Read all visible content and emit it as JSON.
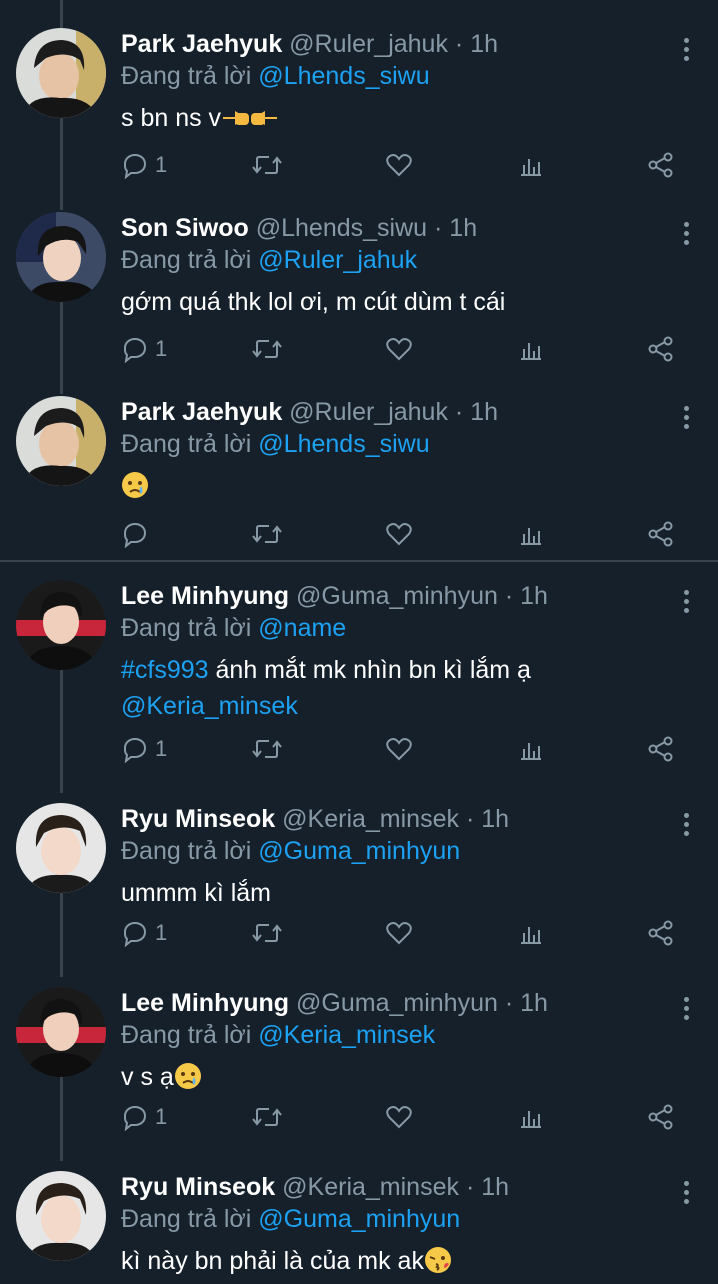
{
  "tweets": [
    {
      "name": "Park Jaehyuk",
      "handle": "@Ruler_jahuk",
      "time": "· 1h",
      "reply_prefix": "Đang trả lời",
      "reply_to": "@Lhends_siwu",
      "text": "s bn ns v",
      "reply_count": "1"
    },
    {
      "name": "Son Siwoo",
      "handle": "@Lhends_siwu",
      "time": "· 1h",
      "reply_prefix": "Đang trả lời",
      "reply_to": "@Ruler_jahuk",
      "text": "gớm quá thk lol ơi, m cút dùm t cái",
      "reply_count": "1"
    },
    {
      "name": "Park Jaehyuk",
      "handle": "@Ruler_jahuk",
      "time": "· 1h",
      "reply_prefix": "Đang trả lời",
      "reply_to": "@Lhends_siwu",
      "text": "",
      "reply_count": ""
    },
    {
      "name": "Lee Minhyung",
      "handle": "@Guma_minhyun",
      "time": "· 1h",
      "reply_prefix": "Đang trả lời",
      "reply_to": "@name",
      "hashtag": "#cfs993",
      "text": "ánh mắt mk nhìn bn kì lắm ạ",
      "mention_line": "@Keria_minsek",
      "reply_count": "1"
    },
    {
      "name": "Ryu Minseok",
      "handle": "@Keria_minsek",
      "time": "· 1h",
      "reply_prefix": "Đang trả lời",
      "reply_to": "@Guma_minhyun",
      "text": "ummm kì lắm",
      "reply_count": "1"
    },
    {
      "name": "Lee Minhyung",
      "handle": "@Guma_minhyun",
      "time": "· 1h",
      "reply_prefix": "Đang trả lời",
      "reply_to": "@Keria_minsek",
      "text": "v s ạ",
      "reply_count": "1"
    },
    {
      "name": "Ryu Minseok",
      "handle": "@Keria_minsek",
      "time": "· 1h",
      "reply_prefix": "Đang trả lời",
      "reply_to": "@Guma_minhyun",
      "text": "kì này bn phải là của mk ak",
      "reply_count": ""
    }
  ],
  "colors": {
    "background": "#15202b",
    "secondary_text": "#8899a6",
    "accent": "#1da1f2"
  }
}
